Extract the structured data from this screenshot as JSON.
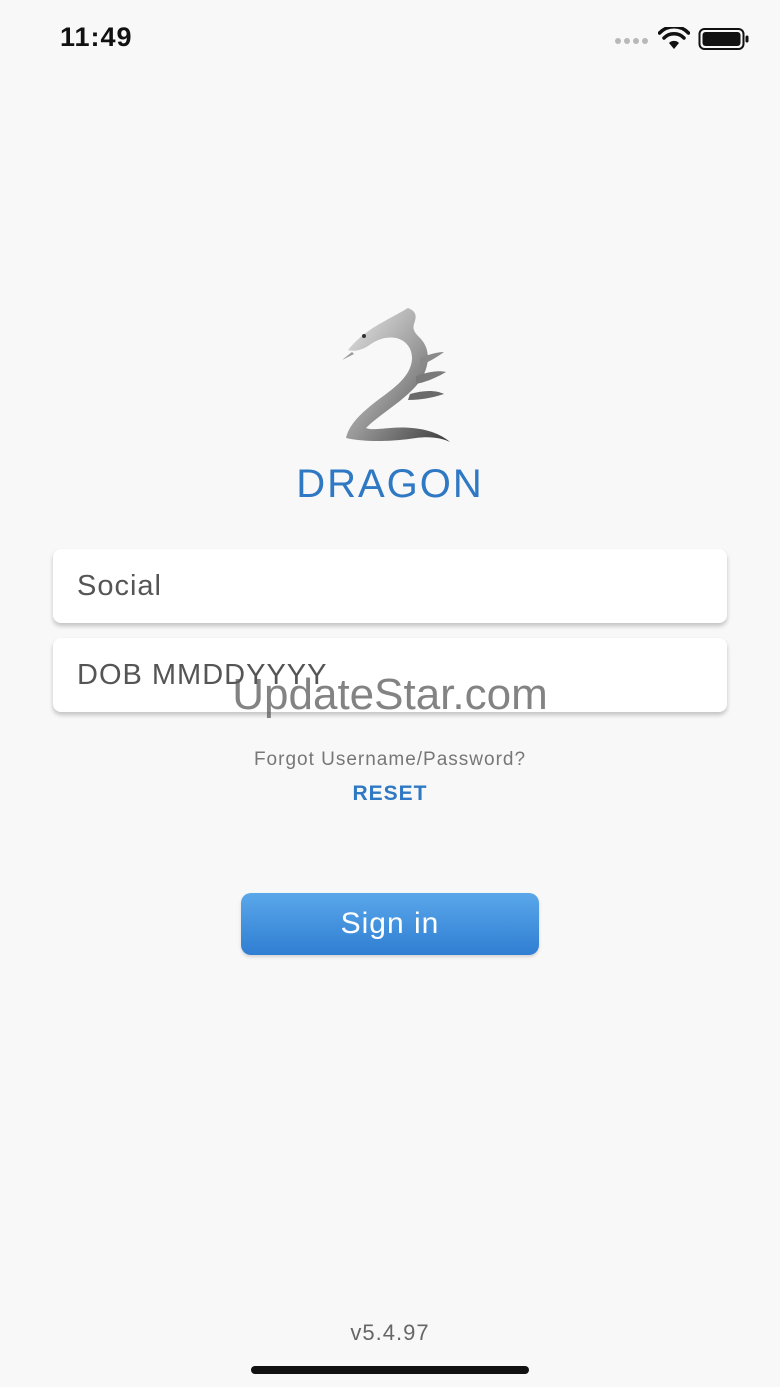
{
  "status_bar": {
    "time": "11:49",
    "icons": [
      "signal-dots-icon",
      "wifi-icon",
      "battery-icon"
    ]
  },
  "brand": {
    "name": "DRAGON",
    "color": "#2f78c4",
    "logo_icon": "dragon-logo-icon"
  },
  "form": {
    "social_placeholder": "Social",
    "dob_placeholder": "DOB MMDDYYYY",
    "forgot_text": "Forgot Username/Password?",
    "reset_label": "RESET",
    "signin_label": "Sign in"
  },
  "watermark": "UpdateStar.com",
  "footer": {
    "version": "v5.4.97"
  }
}
